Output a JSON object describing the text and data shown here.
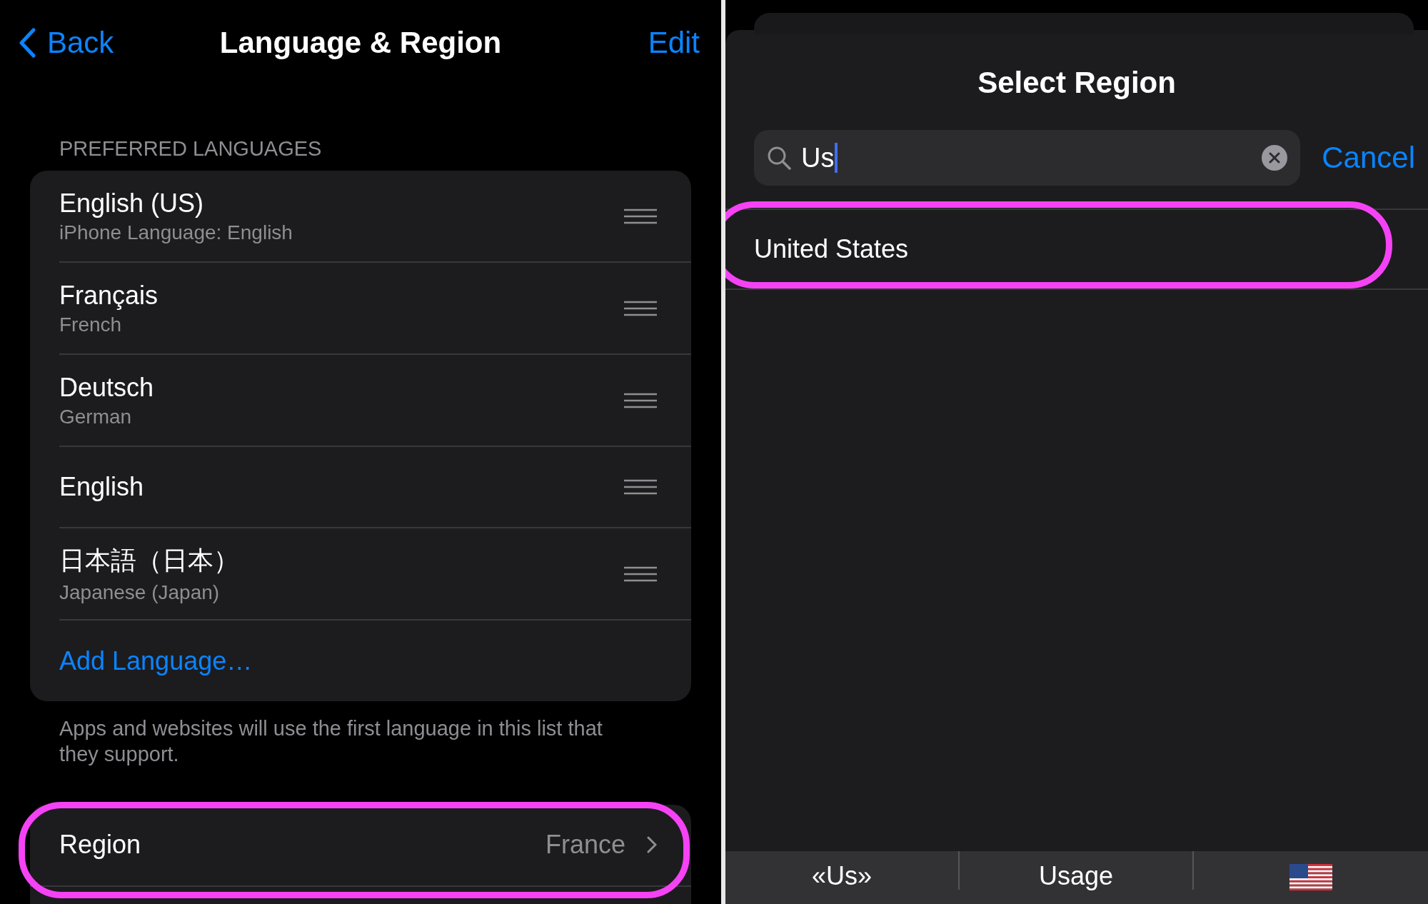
{
  "left": {
    "nav": {
      "back": "Back",
      "title": "Language & Region",
      "edit": "Edit"
    },
    "section_header": "PREFERRED LANGUAGES",
    "languages": [
      {
        "name": "English (US)",
        "subtitle": "iPhone Language: English"
      },
      {
        "name": "Français",
        "subtitle": "French"
      },
      {
        "name": "Deutsch",
        "subtitle": "German"
      },
      {
        "name": "English"
      },
      {
        "name": "日本語（日本）",
        "subtitle": "Japanese (Japan)"
      }
    ],
    "add_language": "Add Language…",
    "footer": "Apps and websites will use the first language in this list that they support.",
    "region": {
      "label": "Region",
      "value": "France",
      "highlighted": true
    }
  },
  "right": {
    "title": "Select Region",
    "search": {
      "value": "Us"
    },
    "cancel": "Cancel",
    "results": [
      {
        "name": "United States",
        "highlighted": true
      }
    ],
    "suggestions": [
      {
        "kind": "text",
        "label": "«Us»"
      },
      {
        "kind": "text",
        "label": "Usage"
      },
      {
        "kind": "flag"
      }
    ]
  }
}
